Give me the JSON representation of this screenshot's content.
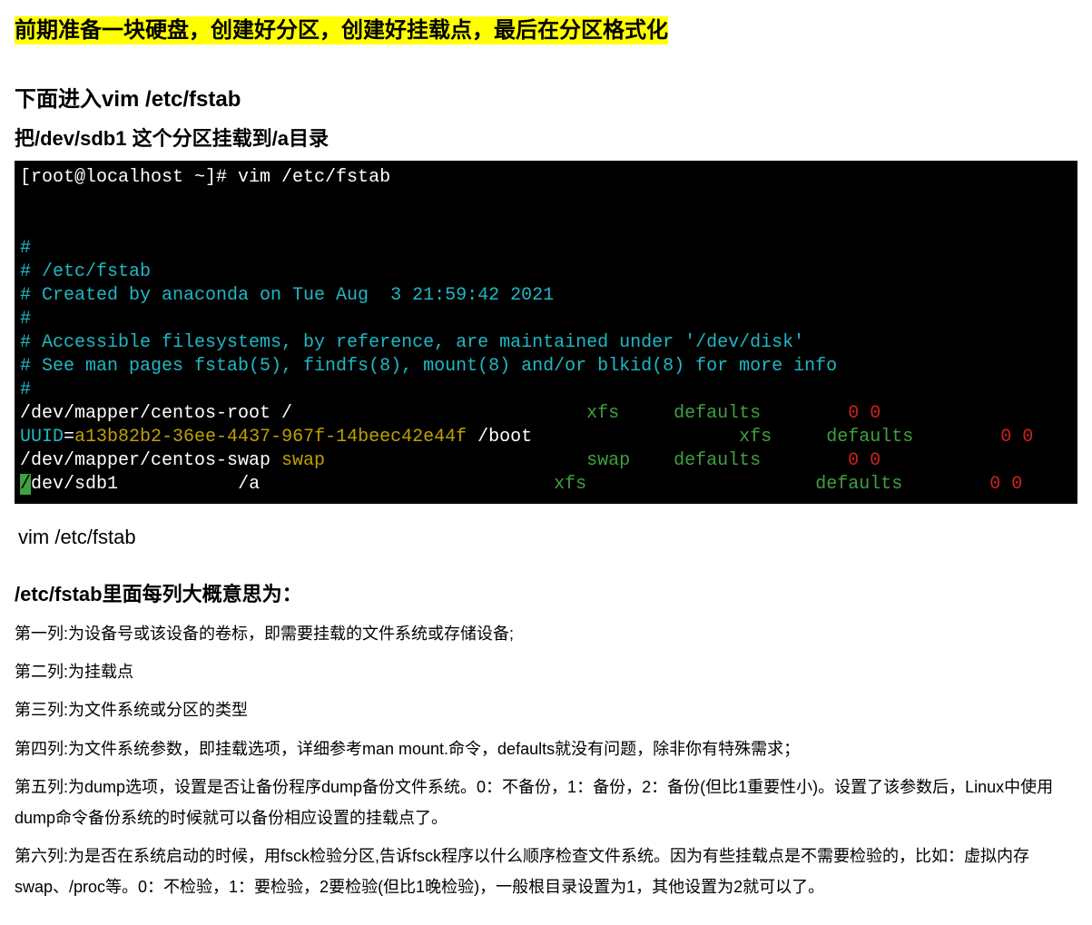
{
  "highlight": "前期准备一块硬盘，创建好分区，创建好挂载点，最后在分区格式化",
  "heading1": "下面进入vim /etc/fstab",
  "heading2": "把/dev/sdb1 这个分区挂载到/a目录",
  "terminal": {
    "prompt": "[root@localhost ~]# vim /etc/fstab",
    "c1": "#",
    "c2": "# /etc/fstab",
    "c3": "# Created by anaconda on Tue Aug  3 21:59:42 2021",
    "c4": "#",
    "c5": "# Accessible filesystems, by reference, are maintained under '/dev/disk'",
    "c6": "# See man pages fstab(5), findfs(8), mount(8) and/or blkid(8) for more info",
    "c7": "#",
    "row1_dev": "/dev/mapper/centos-root /",
    "row1_fs": "xfs",
    "row1_opts": "defaults",
    "row1_nums": "0 0",
    "row2_uuid_label": "UUID",
    "row2_eq": "=",
    "row2_uuid": "a13b82b2-36ee-4437-967f-14beec42e44f",
    "row2_mount": " /boot",
    "row2_fs": "xfs",
    "row2_opts": "defaults",
    "row2_nums": "0 0",
    "row3_dev": "/dev/mapper/centos-swap ",
    "row3_swap": "swap",
    "row3_fs": "swap",
    "row3_opts": "defaults",
    "row3_nums": "0 0",
    "row4_cursor": "/",
    "row4_dev": "dev/sdb1",
    "row4_mount": "/a",
    "row4_fs": "xfs",
    "row4_opts": "defaults",
    "row4_nums": "0 0"
  },
  "plain_cmd": "vim /etc/fstab",
  "desc_head": "/etc/fstab里面每列大概意思为：",
  "desc": {
    "l1": "第一列:为设备号或该设备的卷标，即需要挂载的文件系统或存储设备;",
    "l2": "第二列:为挂载点",
    "l3": "第三列:为文件系统或分区的类型",
    "l4": "第四列:为文件系统参数，即挂载选项，详细参考man mount.命令，defaults就没有问题，除非你有特殊需求；",
    "l5": "第五列:为dump选项，设置是否让备份程序dump备份文件系统。0：不备份，1：备份，2：备份(但比1重要性小)。设置了该参数后，Linux中使用dump命令备份系统的时候就可以备份相应设置的挂载点了。",
    "l6": "第六列:为是否在系统启动的时候，用fsck检验分区,告诉fsck程序以什么顺序检查文件系统。因为有些挂载点是不需要检验的，比如：虚拟内存swap、/proc等。0：不检验，1：要检验，2要检验(但比1晚检验)，一般根目录设置为1，其他设置为2就可以了。"
  }
}
